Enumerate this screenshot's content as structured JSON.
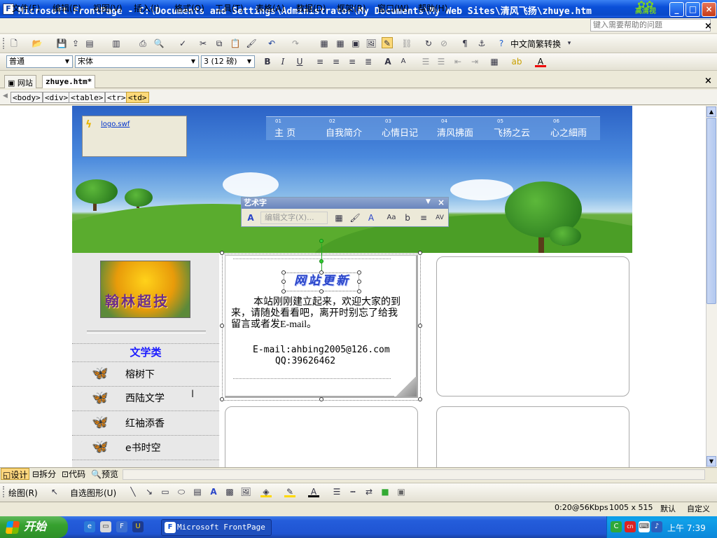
{
  "window": {
    "title": "Microsoft FrontPage - C:\\Documents and Settings\\Administrator\\My Documents\\My Web Sites\\清风飞扬\\zhuye.htm",
    "brand": "高清视",
    "controls": {
      "minimize": "_",
      "maximize": "□",
      "close": "×"
    }
  },
  "menu": {
    "items": [
      "文件(F)",
      "编辑(E)",
      "视图(V)",
      "插入(I)",
      "格式(O)",
      "工具(T)",
      "表格(A)",
      "数据(D)",
      "框架(R)",
      "窗口(W)",
      "帮助(H)"
    ],
    "help_placeholder": "键入需要帮助的问题"
  },
  "toolbar_standard": {
    "convert_label": "中文简繁转换"
  },
  "toolbar_format": {
    "style": "普通",
    "font": "宋体",
    "size": "3 (12 磅)"
  },
  "doc_tabs": {
    "website": "网站",
    "file": "zhuye.htm*"
  },
  "tag_path": [
    "<body>",
    "<div>",
    "<table>",
    "<tr>",
    "<td>"
  ],
  "banner": {
    "flash_file": "logo.swf",
    "nav": [
      {
        "num": "01",
        "label": "主  页"
      },
      {
        "num": "02",
        "label": "自我简介"
      },
      {
        "num": "03",
        "label": "心情日记"
      },
      {
        "num": "04",
        "label": "清风拂面"
      },
      {
        "num": "05",
        "label": "飞扬之云"
      },
      {
        "num": "06",
        "label": "心之細雨"
      }
    ]
  },
  "wordart_toolbar": {
    "title": "艺术字",
    "edit_text": "编辑文字(X)...",
    "buttons": [
      "Aa",
      "AV"
    ]
  },
  "sidebar": {
    "image_text": "翰林超技",
    "category": "文学类",
    "items": [
      "榕树下",
      "西陆文学",
      "红袖添香",
      "e书时空"
    ]
  },
  "content": {
    "wordart": "网站更新",
    "paragraph": "本站刚刚建立起来，欢迎大家的到来，请随处看看吧，离开时别忘了给我留言或者发E-mail。",
    "email": "E-mail:ahbing2005@126.com",
    "qq": "QQ:39626462"
  },
  "view_tabs": [
    "设计",
    "拆分",
    "代码",
    "预览"
  ],
  "drawing_toolbar": {
    "draw": "绘图(R)",
    "autoshapes": "自选图形(U)"
  },
  "status": {
    "speed": "0:20@56Kbps",
    "size": "1005 x 515",
    "mode1": "默认",
    "mode2": "自定义"
  },
  "taskbar": {
    "start": "开始",
    "task": "Microsoft FrontPage",
    "clock": "上午 7:39"
  },
  "colors": {
    "titlebar": "#0a4fd8",
    "nav_text": "#ffffff",
    "category_text": "#1a1aff",
    "selected_tag": "#fcd979"
  }
}
